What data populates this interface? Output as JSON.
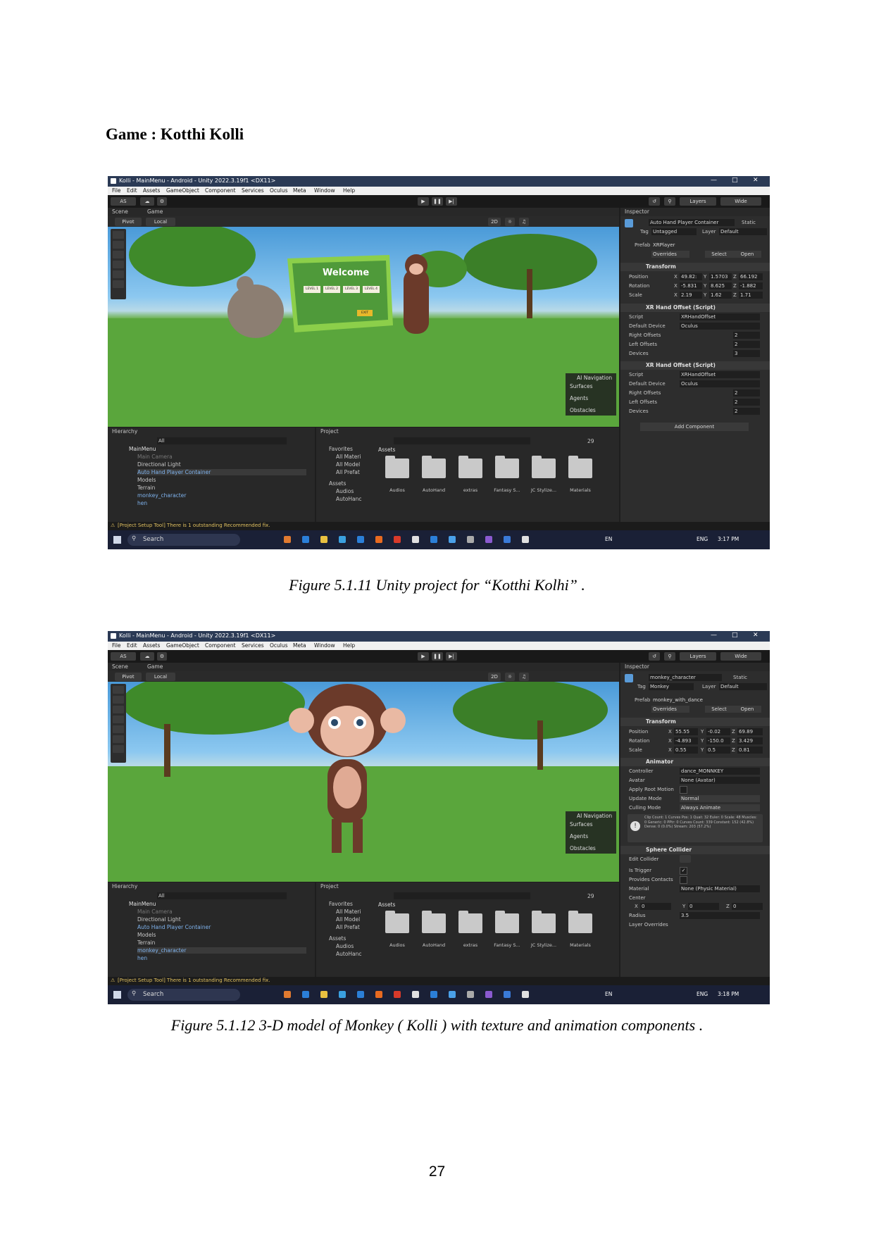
{
  "heading": "Game : Kotthi Kolli",
  "figure1": {
    "caption": "Figure  5.1.11 Unity project for “Kotthi Kolhi” .",
    "window_title": "Kolli - MainMenu - Android - Unity 2022.3.19f1 <DX11>",
    "menu": [
      "File",
      "Edit",
      "Assets",
      "GameObject",
      "Component",
      "Services",
      "Oculus",
      "Meta",
      "Window",
      "Help"
    ],
    "toolbar": {
      "account": "AS",
      "layers": "Layers",
      "layout": "Wide"
    },
    "tabs": {
      "scene": "Scene",
      "game": "Game",
      "inspector": "Inspector",
      "hierarchy": "Hierarchy",
      "project": "Project"
    },
    "scene_toolbar": {
      "pivot": "Pivot",
      "local": "Local",
      "mode_2d": "2D"
    },
    "game_ui": {
      "title": "Welcome",
      "levels": [
        "LEVEL 1",
        "LEVEL 2",
        "LEVEL 3",
        "LEVEL 4"
      ],
      "exit": "EXIT"
    },
    "ai_nav": {
      "title": "AI Navigation",
      "items": [
        "Surfaces",
        "Agents",
        "Obstacles"
      ]
    },
    "inspector": {
      "object_name": "Auto Hand Player Container",
      "static": "Static",
      "tag_label": "Tag",
      "tag": "Untagged",
      "layer_label": "Layer",
      "layer": "Default",
      "prefab_label": "Prefab",
      "prefab": "XRPlayer",
      "overrides": "Overrides",
      "select": "Select",
      "open": "Open",
      "transform": {
        "title": "Transform",
        "position": {
          "label": "Position",
          "x": "49.82:",
          "y": "1.5703",
          "z": "66.192"
        },
        "rotation": {
          "label": "Rotation",
          "x": "-5.831",
          "y": "8.625",
          "z": "-1.882"
        },
        "scale": {
          "label": "Scale",
          "x": "2.19",
          "y": "1.62",
          "z": "1.71"
        }
      },
      "components": [
        {
          "title": "XR Hand Offset (Script)",
          "script": "XRHandOffset",
          "default_device": "Oculus",
          "right_offsets": "2",
          "left_offsets": "2",
          "devices": "3"
        },
        {
          "title": "XR Hand Offset (Script)",
          "script": "XRHandOffset",
          "default_device": "Oculus",
          "right_offsets": "2",
          "left_offsets": "2",
          "devices": "2"
        }
      ],
      "labels": {
        "script": "Script",
        "default_device": "Default Device",
        "right_offsets": "Right Offsets",
        "left_offsets": "Left Offsets",
        "devices": "Devices"
      },
      "add_component": "Add Component"
    },
    "hierarchy": {
      "search": "All",
      "scene": "MainMenu",
      "items": [
        "Main Camera",
        "Directional Light",
        "Auto Hand Player Container",
        "Models",
        "Terrain",
        "monkey_character",
        "hen"
      ]
    },
    "project": {
      "favorites": "Favorites",
      "favorite_items": [
        "All Materi",
        "All Model",
        "All Prefat"
      ],
      "assets_title": "Assets",
      "assets_tree": [
        "Audios",
        "AutoHanc"
      ],
      "folders": [
        "Audios",
        "AutoHand",
        "extras",
        "Fantasy S...",
        "JC Stylize...",
        "Materials"
      ],
      "count": "29"
    },
    "status": "[Project Setup Tool] There is 1 outstanding Recommended fix.",
    "taskbar": {
      "search": "Search",
      "lang": "EN",
      "lang2": "ENG",
      "time": "3:17 PM"
    }
  },
  "figure2": {
    "caption": "Figure  5.1.12 3-D model of Monkey ( Kolli ) with texture and animation components  .",
    "window_title": "Kolli - MainMenu - Android - Unity 2022.3.19f1 <DX11>",
    "menu": [
      "File",
      "Edit",
      "Assets",
      "GameObject",
      "Component",
      "Services",
      "Oculus",
      "Meta",
      "Window",
      "Help"
    ],
    "toolbar": {
      "account": "AS",
      "layers": "Layers",
      "layout": "Wide"
    },
    "tabs": {
      "scene": "Scene",
      "game": "Game",
      "inspector": "Inspector",
      "hierarchy": "Hierarchy",
      "project": "Project"
    },
    "scene_toolbar": {
      "pivot": "Pivot",
      "local": "Local",
      "mode_2d": "2D"
    },
    "ai_nav": {
      "title": "AI Navigation",
      "items": [
        "Surfaces",
        "Agents",
        "Obstacles"
      ]
    },
    "inspector": {
      "object_name": "monkey_character",
      "static": "Static",
      "tag_label": "Tag",
      "tag": "Monkey",
      "layer_label": "Layer",
      "layer": "Default",
      "prefab_label": "Prefab",
      "prefab": "monkey_with_dance",
      "overrides": "Overrides",
      "select": "Select",
      "open": "Open",
      "transform": {
        "title": "Transform",
        "position": {
          "label": "Position",
          "x": "55.55",
          "y": "-0.02",
          "z": "69.89"
        },
        "rotation": {
          "label": "Rotation",
          "x": "-4.893",
          "y": "-150.0",
          "z": "3.429"
        },
        "scale": {
          "label": "Scale",
          "x": "0.55",
          "y": "0.5",
          "z": "0.81"
        }
      },
      "animator": {
        "title": "Animator",
        "controller_label": "Controller",
        "controller": "dance_MONNKEY",
        "avatar_label": "Avatar",
        "avatar": "None (Avatar)",
        "root_motion_label": "Apply Root Motion",
        "update_mode_label": "Update Mode",
        "update_mode": "Normal",
        "culling_mode_label": "Culling Mode",
        "culling_mode": "Always Animate",
        "info": "Clip Count: 1 Curves Pos: 1 Quat: 32 Euler: 0 Scale: 48 Muscles: 0 Generic: 0 PPtr: 0 Curves Count: 339 Constant: 152 (42.8%) Dense: 0 (0.0%) Stream: 203 (57.2%)"
      },
      "sphere_collider": {
        "title": "Sphere Collider",
        "edit_label": "Edit Collider",
        "trigger_label": "Is Trigger",
        "contacts_label": "Provides Contacts",
        "material_label": "Material",
        "material": "None (Physic Material)",
        "center_label": "Center",
        "center_x": "0",
        "center_y": "0",
        "center_z": "0",
        "radius_label": "Radius",
        "radius": "3.5",
        "layer_overrides": "Layer Overrides"
      }
    },
    "hierarchy": {
      "search": "All",
      "scene": "MainMenu",
      "items": [
        "Main Camera",
        "Directional Light",
        "Auto Hand Player Container",
        "Models",
        "Terrain",
        "monkey_character",
        "hen"
      ]
    },
    "project": {
      "favorites": "Favorites",
      "favorite_items": [
        "All Materi",
        "All Model",
        "All Prefat"
      ],
      "assets_title": "Assets",
      "assets_tree": [
        "Audios",
        "AutoHanc"
      ],
      "folders": [
        "Audios",
        "AutoHand",
        "extras",
        "Fantasy S...",
        "JC Stylize...",
        "Materials"
      ],
      "count": "29"
    },
    "status": "[Project Setup Tool] There is 1 outstanding Recommended fix.",
    "taskbar": {
      "search": "Search",
      "lang": "EN",
      "lang2": "ENG",
      "time": "3:18 PM"
    }
  },
  "page_number": "27"
}
